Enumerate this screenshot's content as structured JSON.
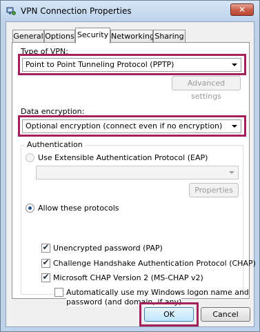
{
  "window": {
    "title": "VPN Connection Properties",
    "close_label": "✕"
  },
  "tabs": [
    {
      "label": "General"
    },
    {
      "label": "Options"
    },
    {
      "label": "Security",
      "active": true
    },
    {
      "label": "Networking"
    },
    {
      "label": "Sharing"
    }
  ],
  "security": {
    "vpn_type_label": "Type of VPN:",
    "vpn_type_value": "Point to Point Tunneling Protocol (PPTP)",
    "advanced_settings_label": "Advanced settings",
    "encryption_label": "Data encryption:",
    "encryption_value": "Optional encryption (connect even if no encryption)",
    "authentication": {
      "legend": "Authentication",
      "eap_option_label": "Use Extensible Authentication Protocol (EAP)",
      "eap_value": "",
      "properties_label": "Properties",
      "allow_protocols_label": "Allow these protocols",
      "protocols": [
        {
          "label": "Unencrypted password (PAP)",
          "checked": true
        },
        {
          "label": "Challenge Handshake Authentication Protocol (CHAP)",
          "checked": true
        },
        {
          "label": "Microsoft CHAP Version 2 (MS-CHAP v2)",
          "checked": true
        }
      ],
      "auto_logon_label_line1": "Automatically use my Windows logon name and",
      "auto_logon_label_line2": "password (and domain, if any)",
      "auto_logon_checked": false
    }
  },
  "footer": {
    "ok_label": "OK",
    "cancel_label": "Cancel"
  },
  "colors": {
    "highlight": "#a4205a",
    "title_gradient_top": "#d6e6f6",
    "title_gradient_bottom": "#bcd3ea",
    "close_button": "#c75b48"
  },
  "icons": {
    "title_icon": "network-connection-icon",
    "checkmark": "✔",
    "combo_arrow": "chevron-down-icon"
  }
}
